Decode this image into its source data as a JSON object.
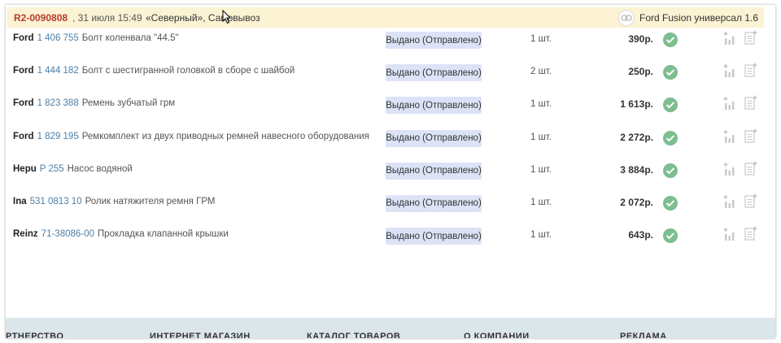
{
  "order": {
    "id": "R2-0090808",
    "date": ", 31 июля 15:49",
    "delivery": "«Северный», Самовывоз",
    "car_icon": "link-icon",
    "car_model": "Ford Fusion универсал 1.6"
  },
  "items": [
    {
      "brand": "Ford",
      "part_no": "1 406 755",
      "desc": "Болт коленвала \"44.5\"",
      "status": "Выдано (Отправлено)",
      "qty": "1 шт.",
      "price": "390р."
    },
    {
      "brand": "Ford",
      "part_no": "1 444 182",
      "desc": "Болт с шестигранной головкой в сборе с шайбой",
      "status": "Выдано (Отправлено)",
      "qty": "2 шт.",
      "price": "250р."
    },
    {
      "brand": "Ford",
      "part_no": "1 823 388",
      "desc": "Ремень зубчатый грм",
      "status": "Выдано (Отправлено)",
      "qty": "1 шт.",
      "price": "1 613р."
    },
    {
      "brand": "Ford",
      "part_no": "1 829 195",
      "desc": "Ремкомплект из двух приводных ремней навесного оборудования",
      "status": "Выдано (Отправлено)",
      "qty": "1 шт.",
      "price": "2 272р."
    },
    {
      "brand": "Hepu",
      "part_no": "P 255",
      "desc": "Насос водяной",
      "status": "Выдано (Отправлено)",
      "qty": "1 шт.",
      "price": "3 884р."
    },
    {
      "brand": "Ina",
      "part_no": "531 0813 10",
      "desc": "Ролик натяжителя ремня ГРМ",
      "status": "Выдано (Отправлено)",
      "qty": "1 шт.",
      "price": "2 072р."
    },
    {
      "brand": "Reinz",
      "part_no": "71-38086-00",
      "desc": "Прокладка клапанной крышки",
      "status": "Выдано (Отправлено)",
      "qty": "1 шт.",
      "price": "643р."
    }
  ],
  "footer": {
    "items": [
      "РТНЕРСТВО",
      "ИНТЕРНЕТ МАГАЗИН",
      "КАТАЛОГ ТОВАРОВ",
      "О КОМПАНИИ",
      "РЕКЛАМА"
    ]
  },
  "colors": {
    "header_bg": "#fbf3d3",
    "order_id": "#b63b2b",
    "part_no": "#4b7fa8",
    "status_bg": "#dde3f6",
    "check": "#7dbd8f",
    "footer_bg": "#dbe6ea"
  }
}
